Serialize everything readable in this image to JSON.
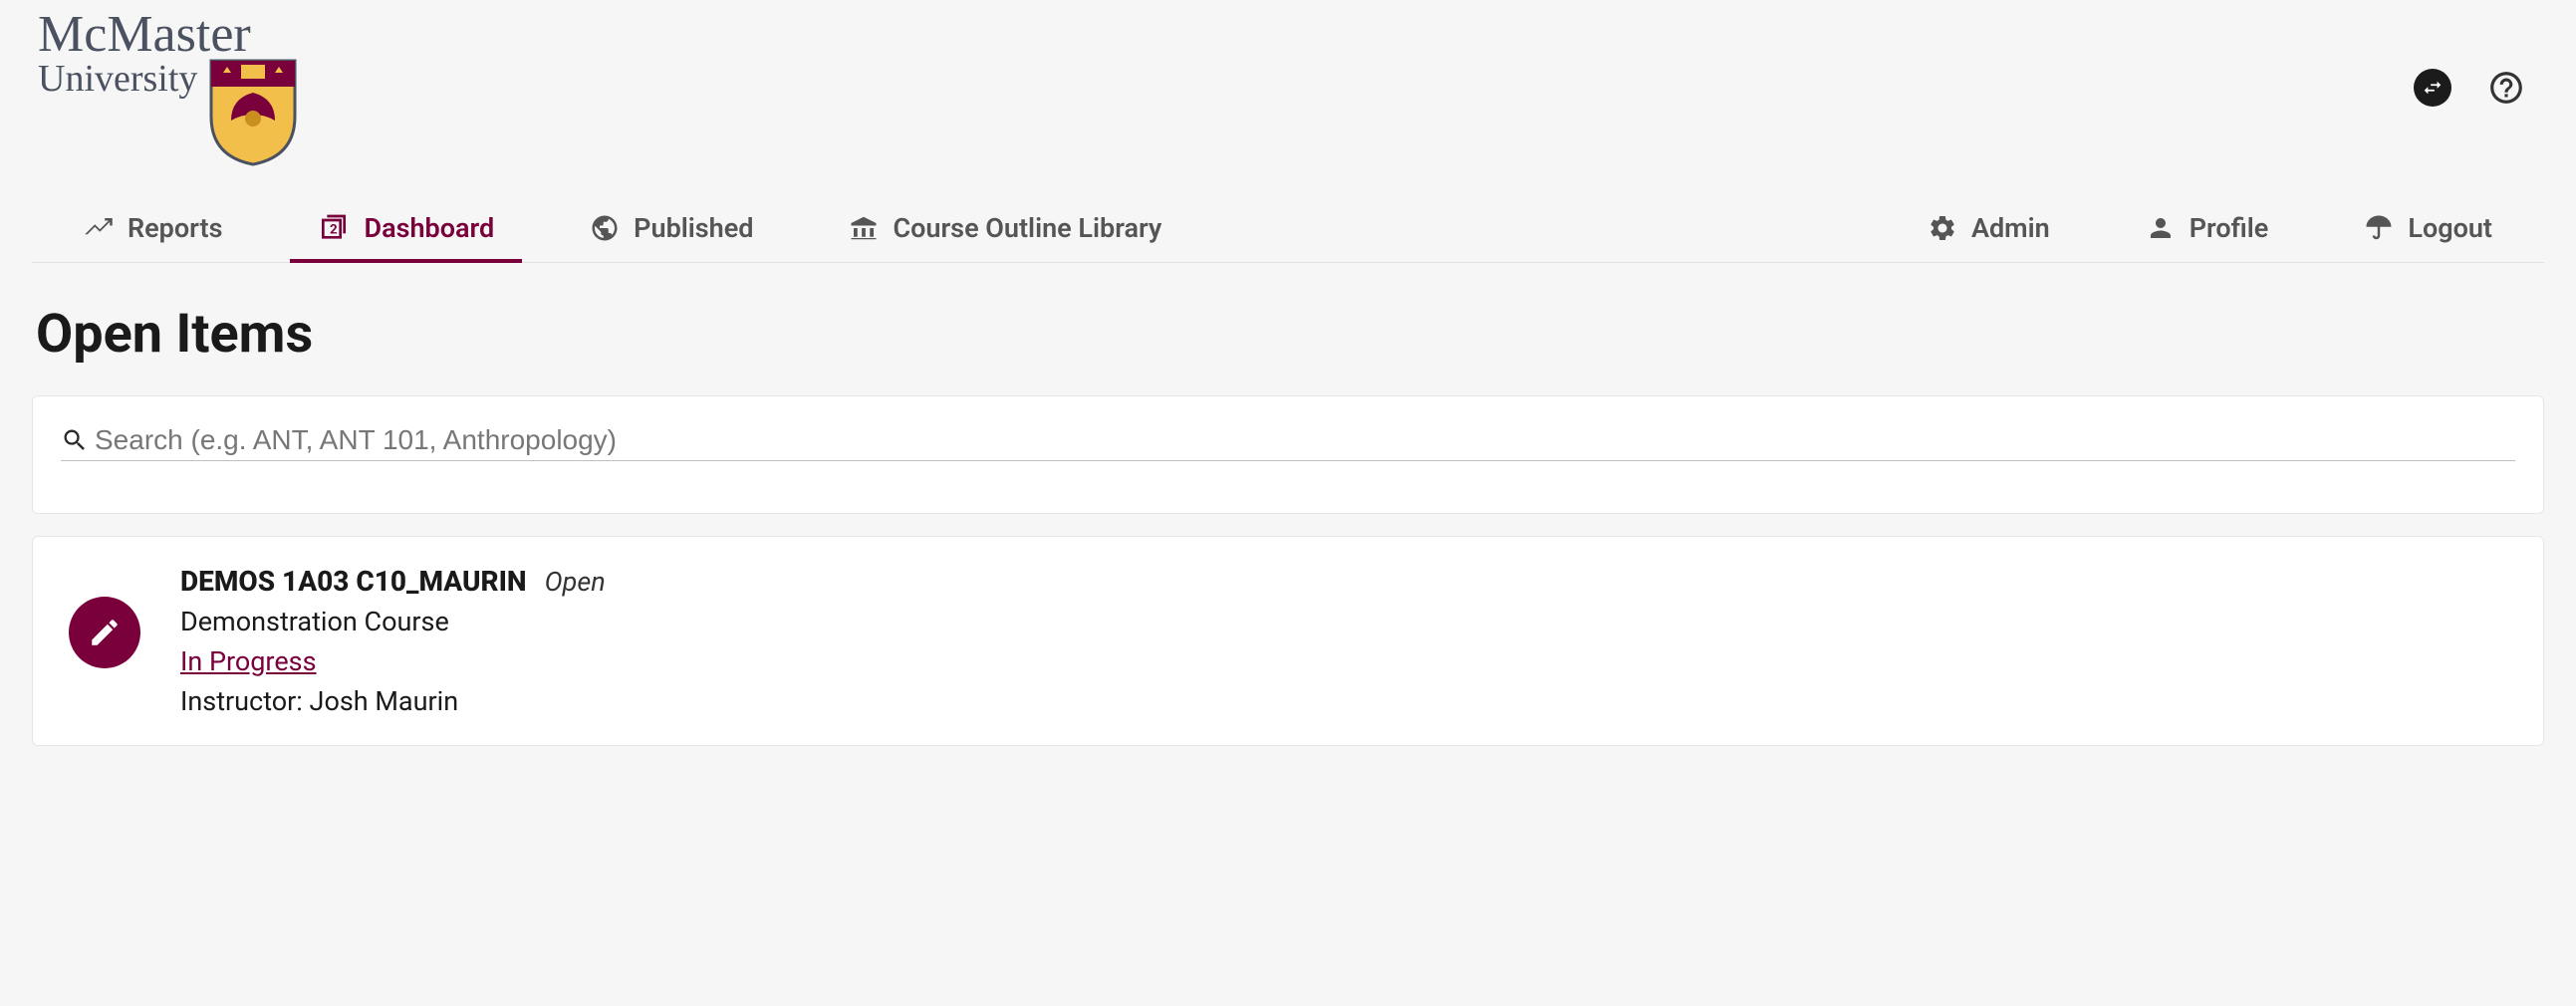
{
  "brand": {
    "line1": "McMaster",
    "line2": "University"
  },
  "nav": {
    "reports": "Reports",
    "dashboard": "Dashboard",
    "published": "Published",
    "library": "Course Outline Library",
    "admin": "Admin",
    "profile": "Profile",
    "logout": "Logout"
  },
  "page": {
    "title": "Open Items"
  },
  "search": {
    "placeholder": "Search (e.g. ANT, ANT 101, Anthropology)",
    "value": ""
  },
  "items": [
    {
      "code": "DEMOS 1A03 C10_MAURIN",
      "state": "Open",
      "name": "Demonstration Course",
      "status": "In Progress",
      "instructor_label": "Instructor: Josh Maurin"
    }
  ]
}
